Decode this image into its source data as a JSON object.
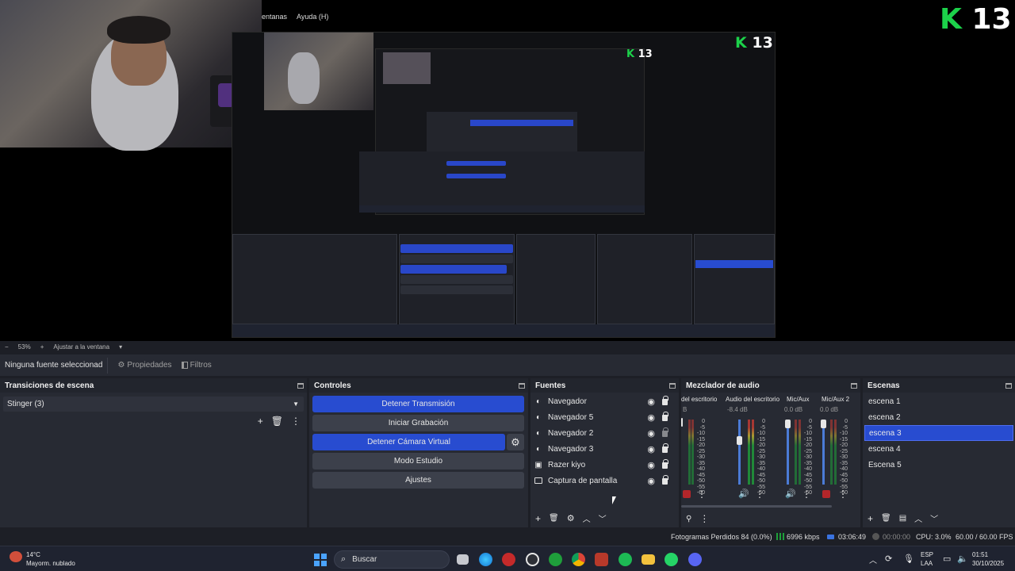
{
  "menu": [
    "entanas",
    "Ayuda (H)"
  ],
  "logo_number": "13",
  "zoom": {
    "minus": "−",
    "value": "53%",
    "plus": "+",
    "fit": "Ajustar a la ventana",
    "arrow": "▾"
  },
  "propbar": {
    "no_source": "Ninguna fuente seleccionad",
    "properties": "Propiedades",
    "filters": "Filtros"
  },
  "docks": {
    "transitions": {
      "title": "Transiciones de escena",
      "selected": "Stinger (3)"
    },
    "controls": {
      "title": "Controles",
      "buttons": [
        "Detener Transmisión",
        "Iniciar Grabación",
        "Detener Cámara Virtual",
        "Modo Estudio",
        "Ajustes"
      ]
    },
    "sources": {
      "title": "Fuentes",
      "items": [
        {
          "name": "Navegador",
          "icon": "browser-icon"
        },
        {
          "name": "Navegador 5",
          "icon": "browser-icon"
        },
        {
          "name": "Navegador 2",
          "icon": "browser-icon"
        },
        {
          "name": "Navegador 3",
          "icon": "browser-icon"
        },
        {
          "name": "Razer kiyo",
          "icon": "camera-icon"
        },
        {
          "name": "Captura de pantalla",
          "icon": "monitor-icon"
        }
      ]
    },
    "mixer": {
      "title": "Mezclador de audio",
      "channels": [
        {
          "name": "del escritorio",
          "db": "B"
        },
        {
          "name": "Audio del escritorio",
          "db": "-8.4 dB"
        },
        {
          "name": "Mic/Aux",
          "db": "0.0 dB"
        },
        {
          "name": "Mic/Aux 2",
          "db": "0.0 dB"
        }
      ],
      "scale": [
        "0",
        "-5",
        "-10",
        "-15",
        "-20",
        "-25",
        "-30",
        "-35",
        "-40",
        "-45",
        "-50",
        "-55",
        "-60"
      ]
    },
    "scenes": {
      "title": "Escenas",
      "items": [
        "escena 1",
        "escena 2",
        "escena 3",
        "escena 4",
        "Escena 5"
      ],
      "selected_index": 2
    }
  },
  "status": {
    "dropped": "Fotogramas Perdidos 84 (0.0%)",
    "kbps": "6996 kbps",
    "stream_time": "03:06:49",
    "rec_time": "00:00:00",
    "cpu": "CPU: 3.0%",
    "fps": "60.00 / 60.00 FPS"
  },
  "taskbar": {
    "temp": "14°C",
    "weather": "Mayorm. nublado",
    "search": "Buscar",
    "lang1": "ESP",
    "lang2": "LAA",
    "time": "01:51",
    "date": "30/10/2025"
  },
  "colors": {
    "accent": "#284cd0",
    "logo_green": "#1cd14a",
    "panel": "#272a33"
  }
}
